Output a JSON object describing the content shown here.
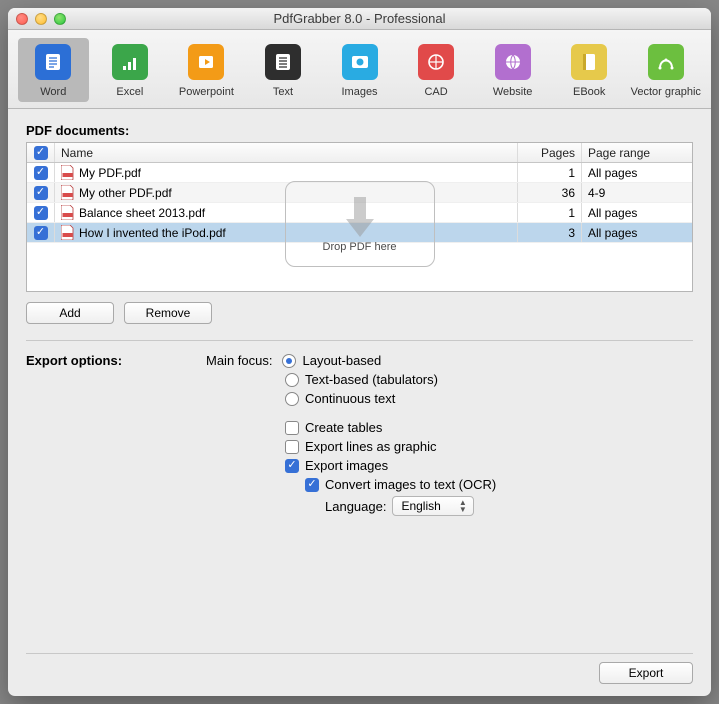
{
  "window": {
    "title": "PdfGrabber 8.0 - Professional"
  },
  "toolbar": {
    "items": [
      {
        "label": "Word",
        "color": "#2c6fd6"
      },
      {
        "label": "Excel",
        "color": "#3ba64a"
      },
      {
        "label": "Powerpoint",
        "color": "#f39b17"
      },
      {
        "label": "Text",
        "color": "#2e2e2e"
      },
      {
        "label": "Images",
        "color": "#29abe2"
      },
      {
        "label": "CAD",
        "color": "#e14a4a"
      },
      {
        "label": "Website",
        "color": "#b26fcf"
      },
      {
        "label": "EBook",
        "color": "#e6c94b"
      },
      {
        "label": "Vector graphic",
        "color": "#6cbf3f"
      }
    ],
    "selectedIndex": 0
  },
  "documents": {
    "heading": "PDF documents:",
    "columns": {
      "name": "Name",
      "pages": "Pages",
      "range": "Page range"
    },
    "rows": [
      {
        "checked": true,
        "name": "My PDF.pdf",
        "pages": 1,
        "range": "All pages"
      },
      {
        "checked": true,
        "name": "My other PDF.pdf",
        "pages": 36,
        "range": "4-9"
      },
      {
        "checked": true,
        "name": "Balance sheet 2013.pdf",
        "pages": 1,
        "range": "All pages"
      },
      {
        "checked": true,
        "name": "How I invented the iPod.pdf",
        "pages": 3,
        "range": "All pages"
      }
    ],
    "selectedRow": 3,
    "dropHint": "Drop PDF here",
    "addLabel": "Add",
    "removeLabel": "Remove"
  },
  "options": {
    "heading": "Export options:",
    "mainFocusLabel": "Main focus:",
    "mainFocus": {
      "selected": 0,
      "choices": [
        "Layout-based",
        "Text-based (tabulators)",
        "Continuous text"
      ]
    },
    "createTables": {
      "label": "Create tables",
      "checked": false
    },
    "exportLinesGraphic": {
      "label": "Export lines as graphic",
      "checked": false
    },
    "exportImages": {
      "label": "Export images",
      "checked": true
    },
    "convertOCR": {
      "label": "Convert images to text (OCR)",
      "checked": true
    },
    "languageLabel": "Language:",
    "languageValue": "English"
  },
  "footer": {
    "exportLabel": "Export"
  }
}
